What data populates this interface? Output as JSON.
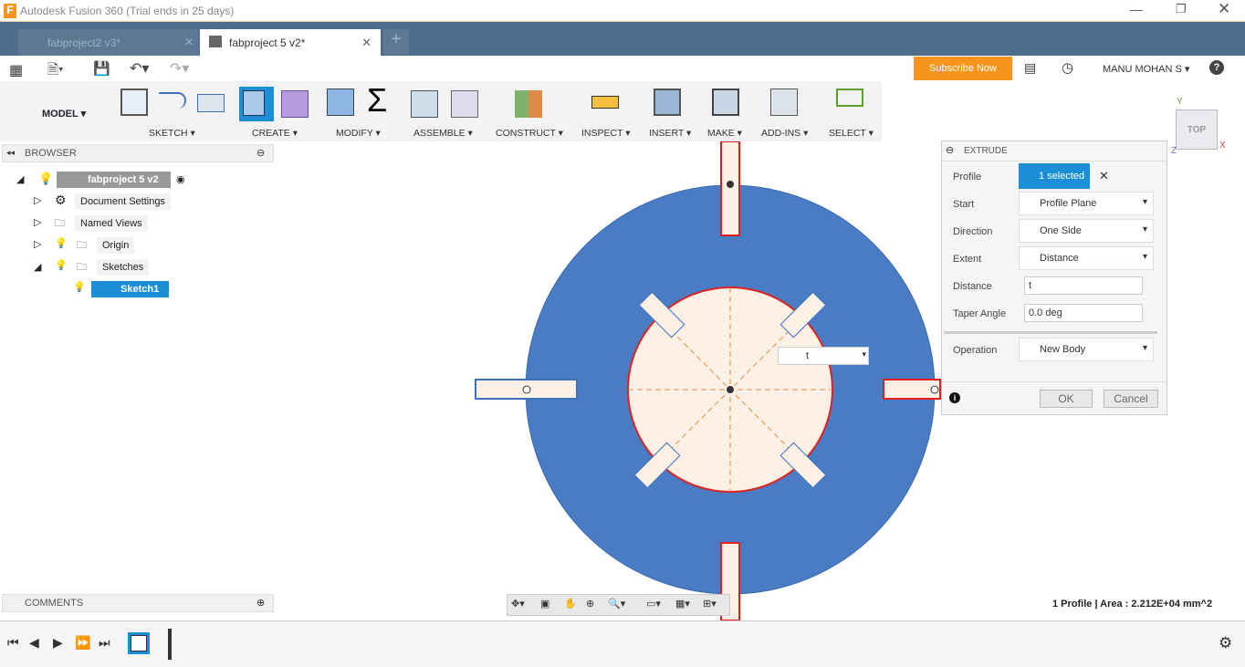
{
  "window": {
    "title": "Autodesk Fusion 360 (Trial ends in 25 days)"
  },
  "tabs": [
    {
      "label": "fabproject2 v3*",
      "active": false
    },
    {
      "label": "fabproject 5 v2*",
      "active": true
    }
  ],
  "header": {
    "subscribe": "Subscribe Now",
    "user": "MANU MOHAN S ▾",
    "help": "?"
  },
  "ribbon": {
    "workspace": "MODEL ▾",
    "groups": [
      "SKETCH ▾",
      "CREATE ▾",
      "MODIFY ▾",
      "ASSEMBLE ▾",
      "CONSTRUCT ▾",
      "INSPECT ▾",
      "INSERT ▾",
      "MAKE ▾",
      "ADD-INS ▾",
      "SELECT ▾"
    ]
  },
  "browser": {
    "title": "BROWSER",
    "root": "fabproject 5 v2",
    "items": [
      "Document Settings",
      "Named Views",
      "Origin",
      "Sketches",
      "Sketch1"
    ]
  },
  "comments": {
    "title": "COMMENTS"
  },
  "viewcube": {
    "face": "TOP",
    "x": "X",
    "y": "Y",
    "z": "Z"
  },
  "canvas": {
    "distance_input": "t",
    "colors": {
      "body": "#4a7cc4",
      "inner": "#fdf1e6",
      "profile": "#e02020"
    }
  },
  "extrude": {
    "title": "EXTRUDE",
    "profile_label": "Profile",
    "profile_value": "1 selected",
    "start_label": "Start",
    "start_value": "Profile Plane",
    "direction_label": "Direction",
    "direction_value": "One Side",
    "extent_label": "Extent",
    "extent_value": "Distance",
    "distance_label": "Distance",
    "distance_value": "t",
    "taper_label": "Taper Angle",
    "taper_value": "0.0 deg",
    "operation_label": "Operation",
    "operation_value": "New Body",
    "ok": "OK",
    "cancel": "Cancel"
  },
  "status": "1 Profile | Area : 2.212E+04 mm^2"
}
